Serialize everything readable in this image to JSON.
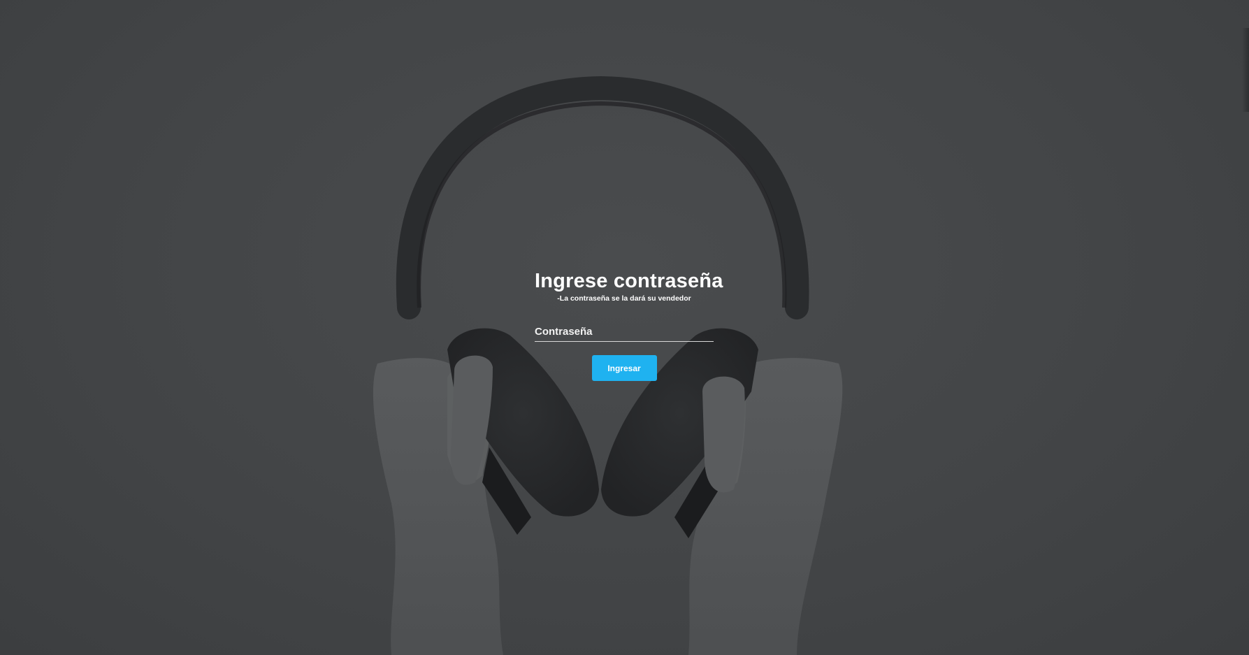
{
  "login": {
    "title": "Ingrese contraseña",
    "hint": "-La contraseña se la dará su vendedor",
    "password_placeholder": "Contraseña",
    "password_value": "",
    "submit_label": "Ingresar"
  },
  "background": {
    "subject": "hands-holding-headphones-photo",
    "overlay_color": "#45474a"
  },
  "colors": {
    "accent": "#1fb2f0",
    "text": "#ffffff"
  }
}
